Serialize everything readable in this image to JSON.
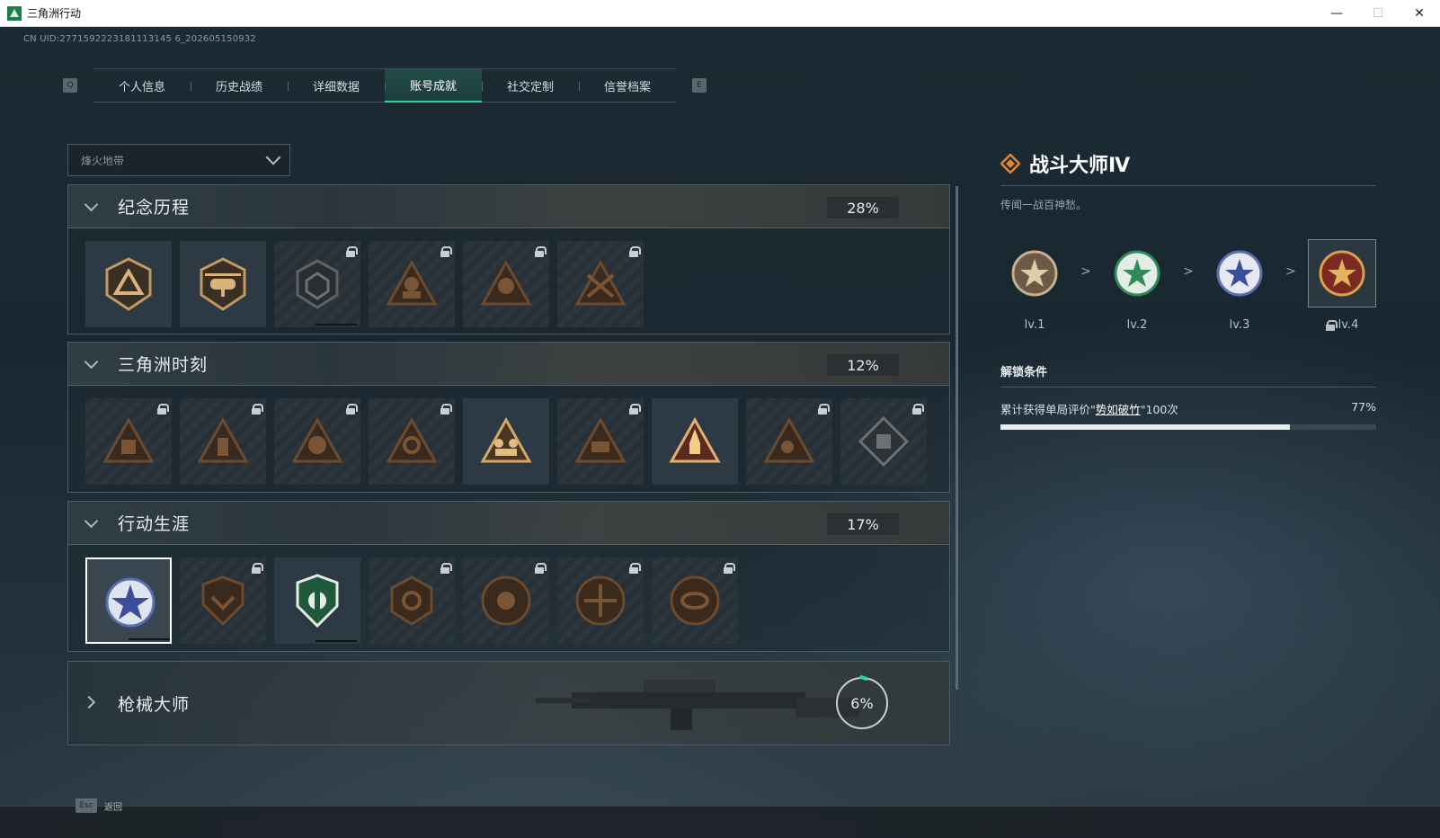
{
  "window": {
    "title": "三角洲行动",
    "min": "—",
    "max": "☐",
    "close": "✕"
  },
  "uid": "CN UID:2771592223181113145 6_202605150932",
  "tabs": {
    "prev_key": "Q",
    "next_key": "E",
    "items": [
      {
        "label": "个人信息",
        "active": false
      },
      {
        "label": "历史战绩",
        "active": false
      },
      {
        "label": "详细数据",
        "active": false
      },
      {
        "label": "账号成就",
        "active": true
      },
      {
        "label": "社交定制",
        "active": false
      },
      {
        "label": "信誉档案",
        "active": false
      }
    ]
  },
  "filter": {
    "selected": "烽火地带"
  },
  "categories": [
    {
      "title": "纪念历程",
      "percent": "28%",
      "badges": 6
    },
    {
      "title": "三角洲时刻",
      "percent": "12%",
      "badges": 9
    },
    {
      "title": "行动生涯",
      "percent": "17%",
      "badges": 7
    },
    {
      "title": "枪械大师",
      "percent": "6%",
      "collapsed": true
    }
  ],
  "detail": {
    "title": "战斗大师Ⅳ",
    "description": "传闻一战百神愁。",
    "levels": [
      "lv.1",
      "lv.2",
      "lv.3",
      "lv.4"
    ],
    "arrow": ">",
    "unlock_heading": "解锁条件",
    "condition_prefix": "累计获得单局评价\"",
    "condition_highlight": "势如破竹",
    "condition_suffix": "\"100次",
    "progress_text": "77%",
    "progress": 0.77
  },
  "footer": {
    "esc_key": "Esc",
    "esc_label": "返回"
  },
  "colors": {
    "accent": "#33d1a0",
    "badge_gold": "#a88a5e",
    "badge_green": "#2f8a5a",
    "badge_blue": "#5a6fb0"
  }
}
